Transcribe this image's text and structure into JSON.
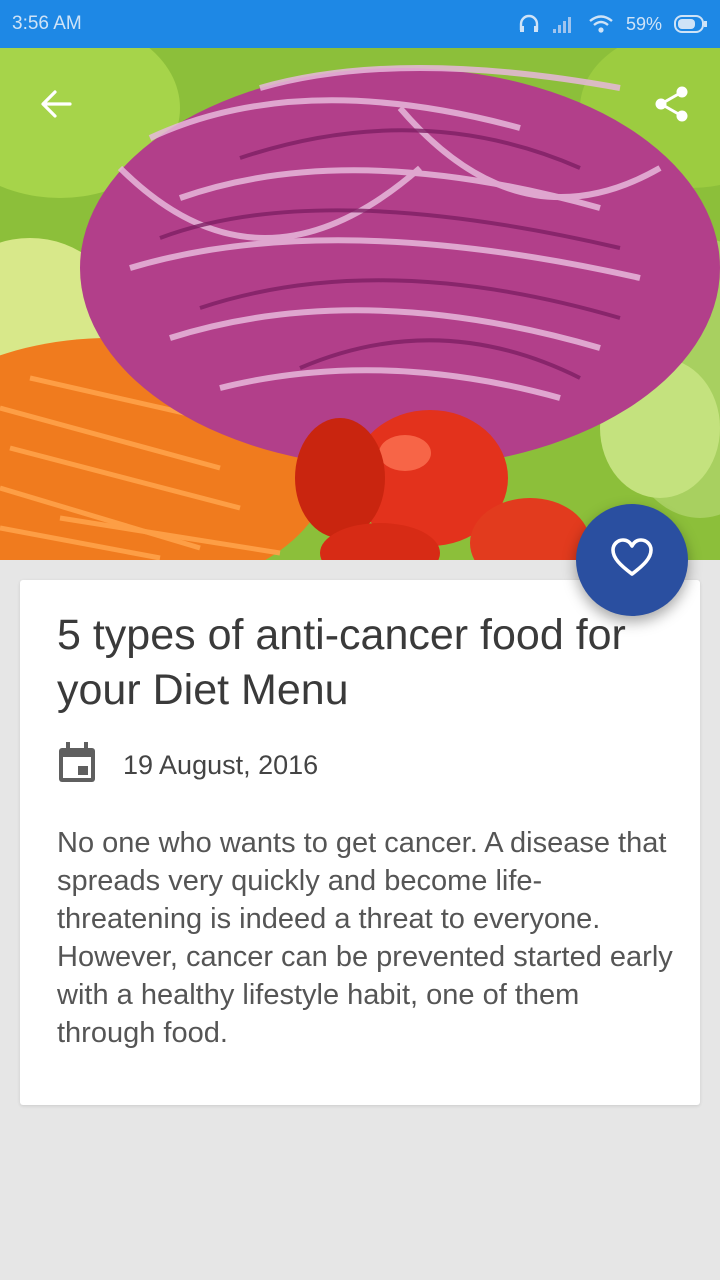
{
  "status_bar": {
    "time": "3:56 AM",
    "battery": "59%"
  },
  "icons": {
    "back": "arrow-back-icon",
    "share": "share-icon",
    "favorite": "heart-outline-icon",
    "calendar": "calendar-icon"
  },
  "colors": {
    "status_bar": "#1e88e5",
    "fab": "#2a4fa0",
    "background": "#e6e6e6",
    "card": "#ffffff"
  },
  "article": {
    "title": "5 types of anti-cancer food for your Diet Menu",
    "date": "19 August, 2016",
    "body": "No one who wants to get cancer. A disease that spreads very quickly and become life-threatening is indeed a threat to everyone. However, cancer can be prevented started early with a healthy lifestyle habit, one of them through food."
  }
}
